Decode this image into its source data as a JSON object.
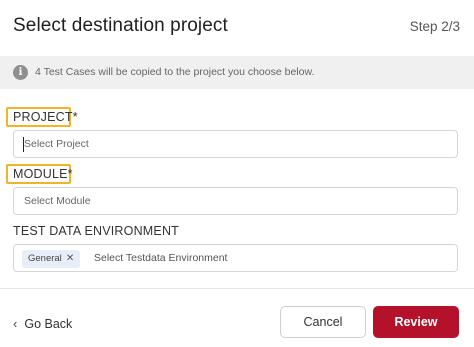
{
  "header": {
    "title": "Select destination project",
    "step": "Step 2/3"
  },
  "info": {
    "icon": "info-icon",
    "text": "4 Test Cases will be copied to the project you choose below."
  },
  "project": {
    "label": "PROJECT*",
    "placeholder": "Select Project"
  },
  "module": {
    "label": "MODULE*",
    "placeholder": "Select Module"
  },
  "environment": {
    "label": "TEST DATA ENVIRONMENT",
    "chip": "General",
    "chip_remove": "✕",
    "placeholder": "Select Testdata Environment"
  },
  "footer": {
    "back_icon": "chevron-left-icon",
    "back_label": "Go Back",
    "cancel_label": "Cancel",
    "review_label": "Review"
  },
  "colors": {
    "highlight": "#f0b429",
    "primary": "#b3122a",
    "banner_bg": "#f0f0f0",
    "chip_bg": "#e8eef8"
  }
}
